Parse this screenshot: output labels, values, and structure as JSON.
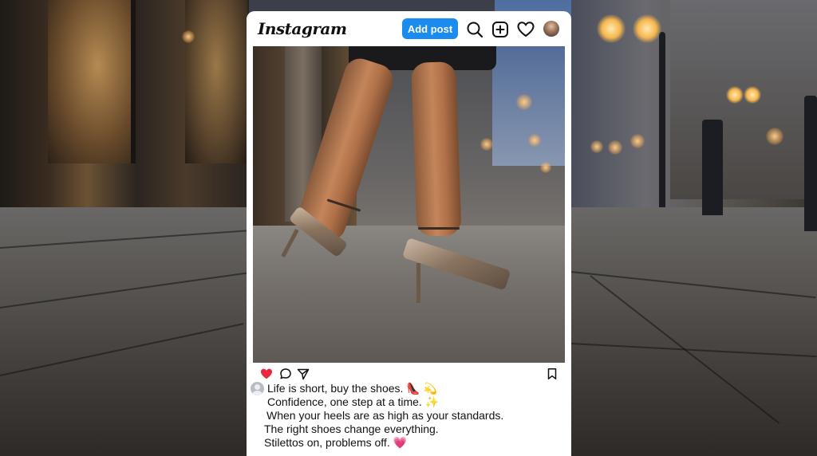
{
  "app": {
    "logo_text": "Instagram"
  },
  "header": {
    "add_post_label": "Add post",
    "icons": [
      "search-icon",
      "new-post-icon",
      "heart-icon",
      "avatar"
    ]
  },
  "post": {
    "image_description_visible": false,
    "actions": {
      "liked": true,
      "icons": [
        "heart-icon",
        "comment-icon",
        "share-icon",
        "bookmark-icon"
      ]
    },
    "caption_lines": [
      "Life is short, buy the shoes. 👠 💫",
      "Confidence, one step at a time. ✨",
      "When your heels are as high as your standards.",
      "The right shoes change everything.",
      "Stilettos on, problems off. 💗"
    ]
  },
  "colors": {
    "accent": "#1a8cf0",
    "like": "#e8283f",
    "card": "#ffffff",
    "text": "#111111"
  }
}
